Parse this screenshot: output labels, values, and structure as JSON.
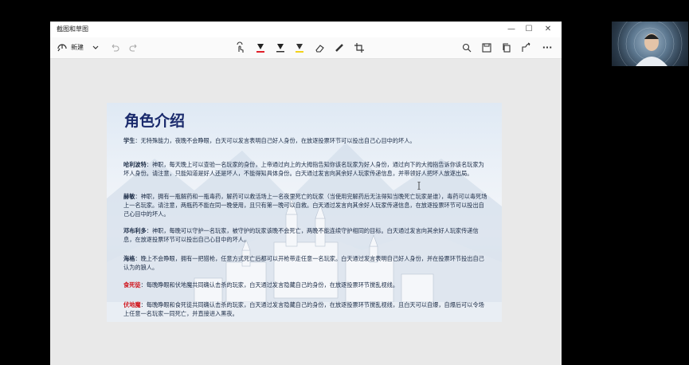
{
  "app": {
    "title": "截图和草图",
    "window_buttons": {
      "minimize": "—",
      "maximize": "☐",
      "close": "✕"
    }
  },
  "toolbar": {
    "new_label": "新建",
    "icons": [
      "new-snip-icon",
      "chevron-down-icon",
      "undo-icon",
      "redo-icon",
      "touch-writing-icon",
      "ballpoint-pen-icon",
      "pencil-icon",
      "highlighter-icon",
      "eraser-icon",
      "ruler-icon",
      "crop-icon",
      "zoom-icon",
      "save-icon",
      "copy-icon",
      "share-icon",
      "more-icon"
    ],
    "more_label": "···"
  },
  "slide": {
    "title": "角色介绍",
    "roles": [
      {
        "name": "学生",
        "text": "：无特殊能力，夜晚不会睁眼，白天可以发言表明自己好人身份，在放逐投票环节可以投出自己心目中的坏人。",
        "red": false
      },
      {
        "name": "哈利波特",
        "text": "：神职，每天晚上可以查验一名玩家的身份，上帝通过向上的大拇指告知你该名玩家为好人身份，通过向下的大拇指告诉你该名玩家为坏人身份。请注意，只能知道是好人还是坏人，不能得知具体身份。白天通过发言向其余好人玩家传递信息，并带领好人把坏人放逐出局。",
        "red": false
      },
      {
        "name": "赫敏",
        "text": "：神职，拥有一瓶解药和一瓶毒药，解药可以救活场上一名夜里死亡的玩家（当使用完解药后无法得知当晚死亡玩家是谁），毒药可以毒死场上一名玩家。请注意，两瓶药不能在同一晚使用，且只有第一晚可以自救。白天通过发言向其余好人玩家传递信息，在放逐投票环节可以投出自己心目中的坏人。",
        "red": false
      },
      {
        "name": "邓布利多",
        "text": "：神职，每晚可以守护一名玩家，被守护的玩家该晚不会死亡，两晚不能连续守护相同的目标。白天通过发言向其余好人玩家传递信息，在放逐投票环节可以投出自己心目中的坏人。",
        "red": false
      },
      {
        "name": "海格",
        "text": "：晚上不会睁眼，拥有一把猎枪，任意方式死亡后都可以开枪带走任意一名玩家。白天通过发言表明自己好人身份，并在投票环节投出自己认为的狼人。",
        "red": false
      },
      {
        "name": "食死徒",
        "text": "：每晚睁眼和伏地魔共同确认击杀的玩家，白天通过发言隐藏自己的身份，在放逐投票环节搅乱视线。",
        "red": true
      },
      {
        "name": "伏地魔",
        "text": "：每晚睁眼和食死徒共同确认击杀的玩家，白天通过发言隐藏自己的身份，在放逐投票环节搅乱视线，且白天可以自爆，自爆后可以令场上任意一名玩家一同死亡，并直接进入黑夜。",
        "red": true
      }
    ]
  },
  "colors": {
    "title_blue": "#1a2a6c",
    "role_red": "#d0141c",
    "text": "#20304a",
    "pen_red": "#e0202a",
    "highlighter_yellow": "#f2d21b"
  }
}
